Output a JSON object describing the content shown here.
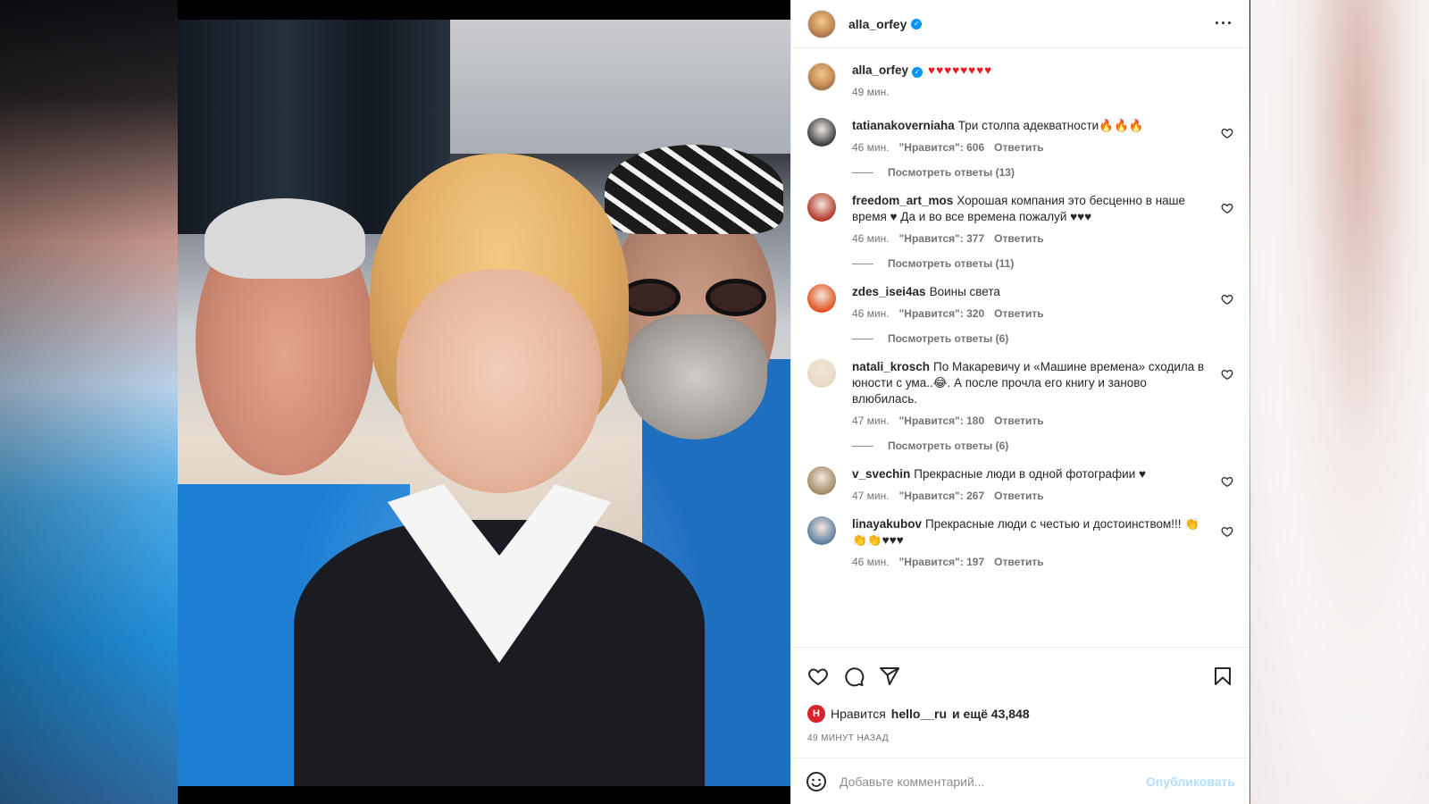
{
  "post": {
    "username": "alla_orfey",
    "verified_icon": "verified-badge-icon",
    "more_icon": "more-horizontal-icon"
  },
  "caption": {
    "username": "alla_orfey",
    "text": "♥♥♥♥♥♥♥♥",
    "time": "49 мин."
  },
  "comments": [
    {
      "username": "tatianakoverniaha",
      "text": "Три столпа адекватности🔥🔥🔥",
      "time": "46 мин.",
      "likes": "\"Нравится\": 606",
      "reply": "Ответить",
      "view_replies": "Посмотреть ответы (13)",
      "avatar_color": "#3a3f46"
    },
    {
      "username": "freedom_art_mos",
      "text": "Хорошая компания это бесценно в наше время ♥ Да и во все времена пожалуй ♥♥♥",
      "time": "46 мин.",
      "likes": "\"Нравится\": 377",
      "reply": "Ответить",
      "view_replies": "Посмотреть ответы (11)",
      "avatar_color": "#b23a2c"
    },
    {
      "username": "zdes_isei4as",
      "text": "Воины света",
      "time": "46 мин.",
      "likes": "\"Нравится\": 320",
      "reply": "Ответить",
      "view_replies": "Посмотреть ответы (6)",
      "avatar_color": "#e2531f"
    },
    {
      "username": "natali_krosch",
      "text": "По Макаревичу и «Машине времена» сходила в юности с ума..😂. А после прочла его книгу и заново влюбилась.",
      "time": "47 мин.",
      "likes": "\"Нравится\": 180",
      "reply": "Ответить",
      "view_replies": "Посмотреть ответы (6)",
      "avatar_color": "#e9d9c3"
    },
    {
      "username": "v_svechin",
      "text": "Прекрасные люди в одной фотографии ♥",
      "time": "47 мин.",
      "likes": "\"Нравится\": 267",
      "reply": "Ответить",
      "view_replies": "",
      "avatar_color": "#a38a66"
    },
    {
      "username": "linayakubov",
      "text": "Прекрасные люди с честью и достоинством!!! 👏👏👏♥♥♥",
      "time": "46 мин.",
      "likes": "\"Нравится\": 197",
      "reply": "Ответить",
      "view_replies": "",
      "avatar_color": "#5c7fa0"
    }
  ],
  "actions": {
    "like_icon": "heart-outline-icon",
    "comment_icon": "comment-bubble-icon",
    "share_icon": "paper-plane-icon",
    "save_icon": "bookmark-icon"
  },
  "likes": {
    "prefix": "Нравится",
    "liker": "hello__ru",
    "suffix": "и ещё 43,848",
    "badge_letter": "H"
  },
  "timestamp": "49 МИНУТ НАЗАД",
  "comment_box": {
    "placeholder": "Добавьте комментарий...",
    "publish_label": "Опубликовать",
    "emoji_icon": "emoji-smile-icon"
  },
  "colors": {
    "verified": "#0095f6",
    "heart": "#ed1c24",
    "publish_disabled": "#b2dffc",
    "meta_text": "#737373"
  }
}
